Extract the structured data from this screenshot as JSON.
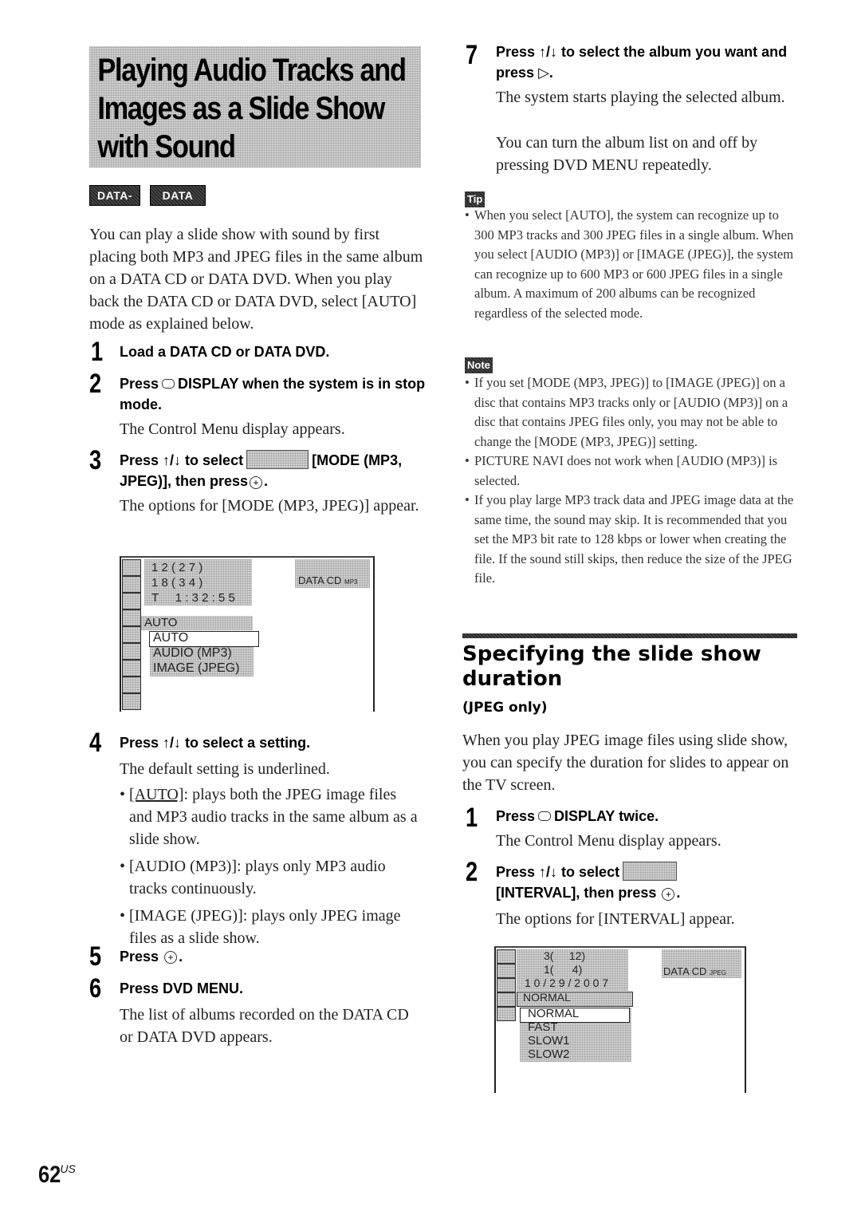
{
  "title": {
    "lines": [
      "Playing Audio Tracks and",
      "Images as a Slide Show",
      "with Sound"
    ]
  },
  "disc_badges": [
    "DATA-CD",
    "DATA DVD"
  ],
  "intro": "You can play a slide show with sound by first placing both MP3 and JPEG files in the same album on a DATA CD or DATA DVD. When you play back the DATA CD or DATA DVD, select [AUTO] mode as explained below.",
  "steps_left": [
    {
      "num": "1",
      "head": "Load a DATA CD or DATA DVD."
    },
    {
      "num": "2",
      "head_pre": "Press",
      "head_icon": "display-button-icon",
      "head_post": "DISPLAY when the system is in stop mode.",
      "body": "The Control Menu display appears."
    },
    {
      "num": "3",
      "head_pre": "Press ↑/↓ to select",
      "head_icon": "mode-mp3-jpeg-menu-icon",
      "head_post": "[MODE (MP3, JPEG)], then press",
      "head_end": ".",
      "body": "The options for [MODE (MP3, JPEG)] appear."
    },
    {
      "num": "4",
      "head": "Press ↑/↓ to select a setting.",
      "body": "The default setting is underlined.",
      "bullets": [
        {
          "term": "[AUTO]",
          "underlined": true,
          "text": ": plays both the JPEG image files and MP3 audio tracks in the same album as a slide show."
        },
        {
          "term": "[AUDIO (MP3)]",
          "underlined": false,
          "text": ": plays only MP3 audio tracks continuously."
        },
        {
          "term": "[IMAGE (JPEG)]",
          "underlined": false,
          "text": ": plays only JPEG image files as a slide show."
        }
      ]
    },
    {
      "num": "5",
      "head_pre": "Press",
      "head_end": "."
    },
    {
      "num": "6",
      "head": "Press DVD MENU.",
      "body": "The list of albums recorded on the DATA CD or DATA DVD appears."
    }
  ],
  "screen1": {
    "rows": [
      "1 2 ( 2 7 )",
      "1 8 ( 3 4 )",
      "T     1 : 3 2 : 5 5"
    ],
    "disc_label": "DATA CD",
    "disc_format": "MP3",
    "current": "AUTO",
    "options": [
      "AUTO",
      "AUDIO (MP3)",
      "IMAGE (JPEG)"
    ],
    "selected_index": 0
  },
  "step7": {
    "num": "7",
    "head_pre": "Press ↑/↓ to select the album you want and press",
    "head_end": ".",
    "body": [
      "The system starts playing the selected album.",
      "You can turn the album list on and off by pressing DVD MENU repeatedly."
    ]
  },
  "tip": {
    "label": "Tip",
    "items": [
      "When you select [AUTO], the system can recognize up to 300 MP3 tracks and 300 JPEG files in a single album. When you select [AUDIO (MP3)] or [IMAGE (JPEG)], the system can recognize up to 600 MP3 or 600 JPEG files in a single album. A maximum of 200 albums can be recognized regardless of the selected mode."
    ]
  },
  "note": {
    "label": "Note",
    "items": [
      "If you set [MODE (MP3, JPEG)] to [IMAGE (JPEG)] on a disc that contains MP3 tracks only or [AUDIO (MP3)] on a disc that contains JPEG files only, you may not be able to change the [MODE (MP3, JPEG)] setting.",
      "PICTURE NAVI does not work when [AUDIO (MP3)] is selected.",
      "If you play large MP3 track data and JPEG image data at the same time, the sound may skip. It is recommended that you set the MP3 bit rate to 128 kbps or lower when creating the file. If the sound still skips, then reduce the size of the JPEG file."
    ]
  },
  "section2": {
    "title": "Specifying the slide show duration",
    "subtitle": "(JPEG only)",
    "intro": "When you play JPEG image files using slide show, you can specify the duration for slides to appear on the TV screen.",
    "steps": [
      {
        "num": "1",
        "head_pre": "Press",
        "head_post": "DISPLAY twice.",
        "body": "The Control Menu display appears."
      },
      {
        "num": "2",
        "head_pre": "Press ↑/↓ to select",
        "head_post": "[INTERVAL], then press",
        "head_end": ".",
        "body": "The options for [INTERVAL] appear."
      }
    ]
  },
  "screen2": {
    "rows": [
      "3(     12)",
      "1(      4)",
      "1 0 / 2 9 / 2 0 0 7"
    ],
    "disc_label": "DATA CD",
    "disc_format": "JPEG",
    "current": "NORMAL",
    "options": [
      "NORMAL",
      "FAST",
      "SLOW1",
      "SLOW2"
    ],
    "selected_index": 0
  },
  "page": {
    "number": "62",
    "suffix": "US"
  }
}
